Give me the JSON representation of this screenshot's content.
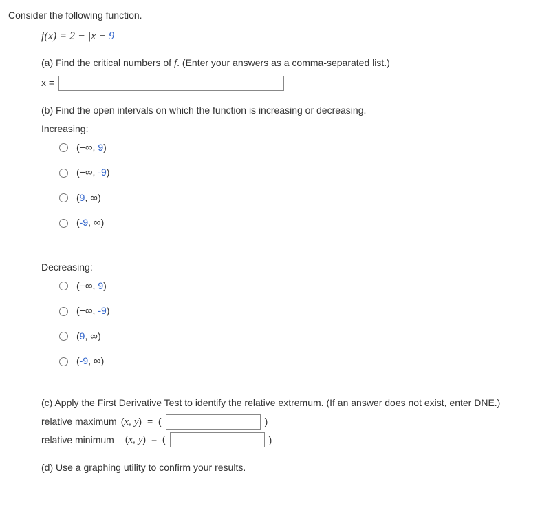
{
  "intro": "Consider the following function.",
  "functionExpr": "f(x) = 2 − |x − 9|",
  "partA": {
    "prompt": "(a) Find the critical numbers of ",
    "promptSuffix": ". (Enter your answers as a comma-separated list.)",
    "var": "x ="
  },
  "partB": {
    "prompt": "(b) Find the open intervals on which the function is increasing or decreasing.",
    "incLabel": "Increasing:",
    "decLabel": "Decreasing:",
    "options": [
      {
        "prefix": "(−∞, ",
        "num": "9",
        "suffix": ")",
        "numClass": "blue"
      },
      {
        "prefix": "(−∞, ",
        "num": "-9",
        "suffix": ")",
        "numClass": "blue"
      },
      {
        "prefix": "(",
        "num": "9",
        "suffix": ", ∞)",
        "numClass": "blue"
      },
      {
        "prefix": "(",
        "num": "-9",
        "suffix": ", ∞)",
        "numClass": "blue"
      }
    ]
  },
  "partC": {
    "prompt": "(c) Apply the First Derivative Test to identify the relative extremum. (If an answer does not exist, enter DNE.)",
    "maxLabel": "relative maximum",
    "minLabel": "relative minimum",
    "coordPrefix": "(x, y)  = "
  },
  "partD": {
    "prompt": "(d) Use a graphing utility to confirm your results."
  }
}
